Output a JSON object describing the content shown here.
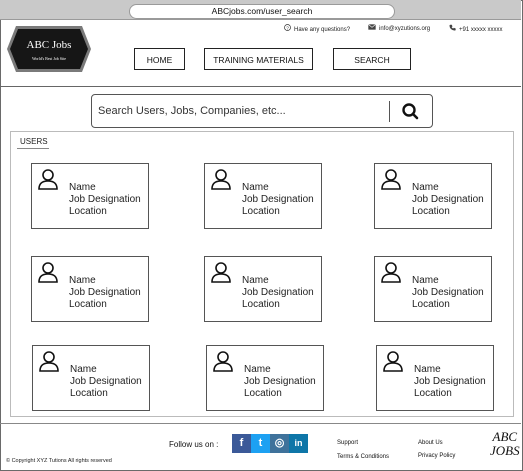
{
  "browser": {
    "url": "ABCjobs.com/user_search"
  },
  "header": {
    "questions": "Have any questions?",
    "email": "info@xyzutions.org",
    "phone": "+91 xxxxx xxxxx",
    "logo_title": "ABC Jobs",
    "logo_tagline": "World's Best Job Site"
  },
  "nav": {
    "home": "HOME",
    "training": "TRAINING MATERIALS",
    "search": "SEARCH"
  },
  "search": {
    "placeholder": "Search Users, Jobs, Companies, etc..."
  },
  "users": {
    "title": "USERS",
    "cards": [
      {
        "name": "Name",
        "designation": "Job Designation",
        "location": "Location"
      },
      {
        "name": "Name",
        "designation": "Job Designation",
        "location": "Location"
      },
      {
        "name": "Name",
        "designation": "Job Designation",
        "location": "Location"
      },
      {
        "name": "Name",
        "designation": "Job Designation",
        "location": "Location"
      },
      {
        "name": "Name",
        "designation": "Job Designation",
        "location": "Location"
      },
      {
        "name": "Name",
        "designation": "Job Designation",
        "location": "Location"
      },
      {
        "name": "Name",
        "designation": "Job Designation",
        "location": "Location"
      },
      {
        "name": "Name",
        "designation": "Job Designation",
        "location": "Location"
      },
      {
        "name": "Name",
        "designation": "Job Designation",
        "location": "Location"
      }
    ]
  },
  "footer": {
    "follow": "Follow us on :",
    "social": [
      {
        "icon": "facebook-icon",
        "glyph": "f",
        "color": "#3b5998"
      },
      {
        "icon": "twitter-icon",
        "glyph": "t",
        "color": "#1da1f2"
      },
      {
        "icon": "instagram-icon",
        "glyph": "◎",
        "color": "#3f729b"
      },
      {
        "icon": "linkedin-icon",
        "glyph": "in",
        "color": "#0e76a8"
      }
    ],
    "support": "Support",
    "terms": "Terms & Conditions",
    "about": "About Us",
    "privacy": "Privacy Policy",
    "logo_line1": "ABC",
    "logo_line2": "JOBS",
    "copyright": "© Copyright XYZ Tutions All rights reserved"
  }
}
